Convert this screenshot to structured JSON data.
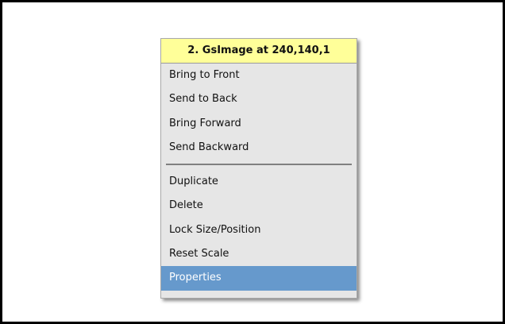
{
  "menu": {
    "header": "2. GsImage at 240,140,1",
    "group_arrange": [
      "Bring to Front",
      "Send to Back",
      "Bring Forward",
      "Send Backward"
    ],
    "group_actions": [
      "Duplicate",
      "Delete",
      "Lock Size/Position",
      "Reset Scale",
      "Properties"
    ],
    "selected_item": "Properties"
  },
  "colors": {
    "header_background": "#ffff99",
    "menu_background": "#e6e6e6",
    "selected_background": "#6699cc",
    "selected_text": "#ffffff"
  }
}
